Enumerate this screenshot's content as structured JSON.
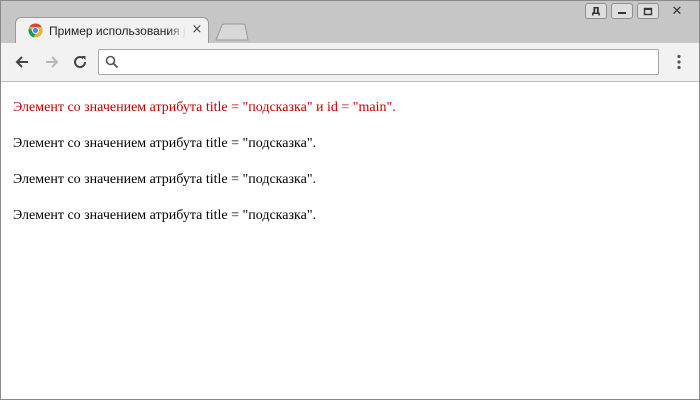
{
  "colors": {
    "highlight_text": "#c00000"
  },
  "tab": {
    "title": "Пример использования jQuery",
    "favicon": "chrome-page-icon",
    "close_glyph": "×"
  },
  "window_controls": {
    "profile_label": "Д",
    "minimize": "minimize-icon",
    "restore": "restore-icon",
    "close_glyph": "✕"
  },
  "toolbar": {
    "address_value": "",
    "address_placeholder": ""
  },
  "page": {
    "paragraphs": [
      "Элемент со значением атрибута title = \"подсказка\" и id = \"main\".",
      "Элемент со значением атрибута title = \"подсказка\".",
      "Элемент со значением атрибута title = \"подсказка\".",
      "Элемент со значением атрибута title = \"подсказка\"."
    ]
  }
}
